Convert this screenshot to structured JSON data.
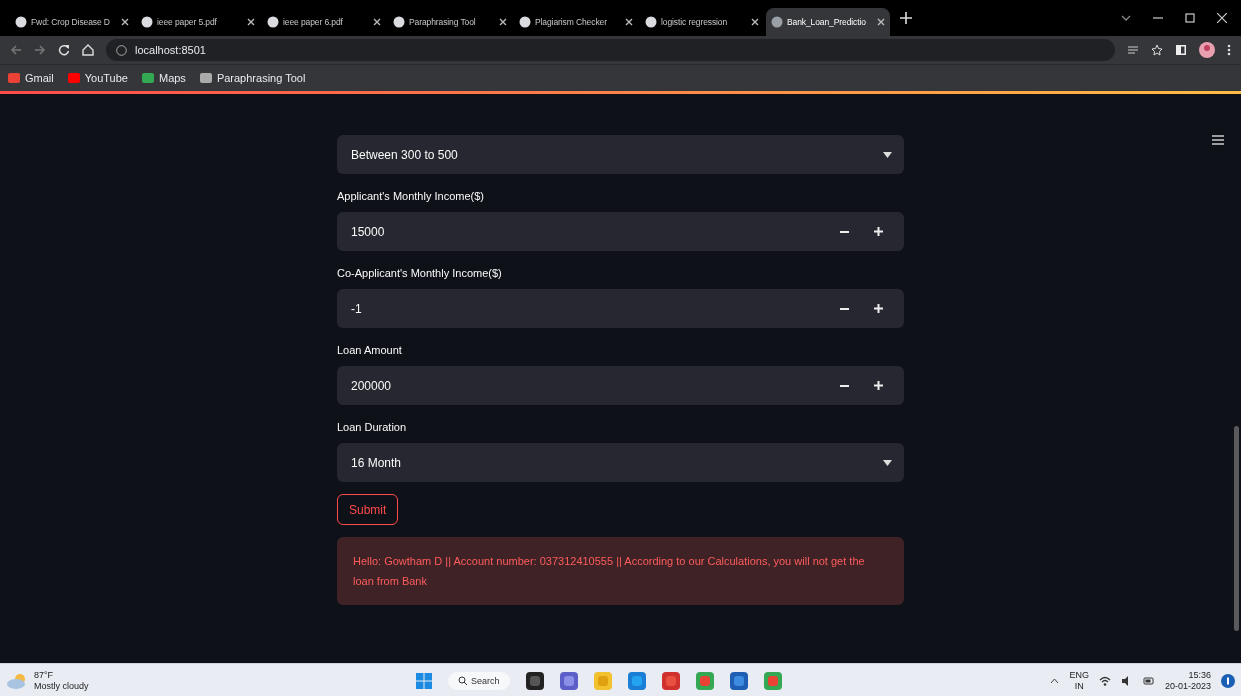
{
  "browser": {
    "tabs": [
      {
        "title": "Fwd: Crop Disease D",
        "selected": false
      },
      {
        "title": "ieee paper 5.pdf",
        "selected": false
      },
      {
        "title": "ieee paper 6.pdf",
        "selected": false
      },
      {
        "title": "Paraphrasing Tool",
        "selected": false
      },
      {
        "title": "Plagiarism Checker",
        "selected": false
      },
      {
        "title": "logistic regression",
        "selected": false
      },
      {
        "title": "Bank_Loan_Predictio",
        "selected": true
      }
    ],
    "address": "localhost:8501",
    "bookmarks": [
      "Gmail",
      "YouTube",
      "Maps",
      "Paraphrasing Tool"
    ]
  },
  "form": {
    "fields": [
      {
        "kind": "select",
        "value": "Between 300 to 500"
      },
      {
        "kind": "number",
        "label": "Applicant's Monthly Income($)",
        "value": "15000"
      },
      {
        "kind": "number",
        "label": "Co-Applicant's Monthly Income($)",
        "value": "-1"
      },
      {
        "kind": "number",
        "label": "Loan Amount",
        "value": "200000"
      },
      {
        "kind": "select",
        "label": "Loan Duration",
        "value": "16 Month"
      }
    ],
    "submit": "Submit",
    "alert": "Hello: Gowtham D || Account number: 037312410555 || According to our Calculations, you will not get the loan from Bank"
  },
  "taskbar": {
    "temperature": "87°F",
    "weather": "Mostly cloudy",
    "search": "Search",
    "language": "ENG",
    "region": "IN",
    "time": "15:36",
    "date": "20-01-2023"
  }
}
